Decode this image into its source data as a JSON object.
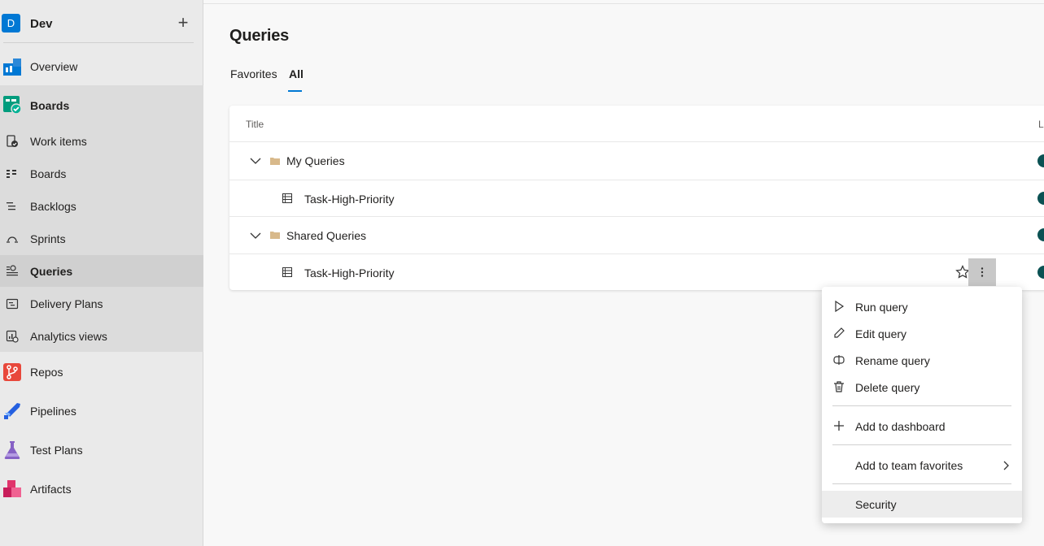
{
  "project": {
    "initial": "D",
    "name": "Dev",
    "add_symbol": "+"
  },
  "nav": {
    "overview": "Overview",
    "boards": "Boards",
    "work_items": "Work items",
    "boards_sub": "Boards",
    "backlogs": "Backlogs",
    "sprints": "Sprints",
    "queries": "Queries",
    "delivery_plans": "Delivery Plans",
    "analytics_views": "Analytics views",
    "repos": "Repos",
    "pipelines": "Pipelines",
    "test_plans": "Test Plans",
    "artifacts": "Artifacts"
  },
  "page": {
    "title": "Queries",
    "tabs": {
      "favorites": "Favorites",
      "all": "All"
    }
  },
  "table": {
    "col_title": "Title",
    "col_last": "La",
    "rows": [
      {
        "label": "My Queries",
        "type": "folder"
      },
      {
        "label": "Task-High-Priority",
        "type": "query"
      },
      {
        "label": "Shared Queries",
        "type": "folder"
      },
      {
        "label": "Task-High-Priority",
        "type": "query"
      }
    ]
  },
  "menu": {
    "run": "Run query",
    "edit": "Edit query",
    "rename": "Rename query",
    "delete": "Delete query",
    "add_dashboard": "Add to dashboard",
    "add_team_fav": "Add to team favorites",
    "security": "Security"
  },
  "colors": {
    "accent": "#0078d4",
    "avatar": "#0b5153",
    "folder": "#d8b98b"
  }
}
